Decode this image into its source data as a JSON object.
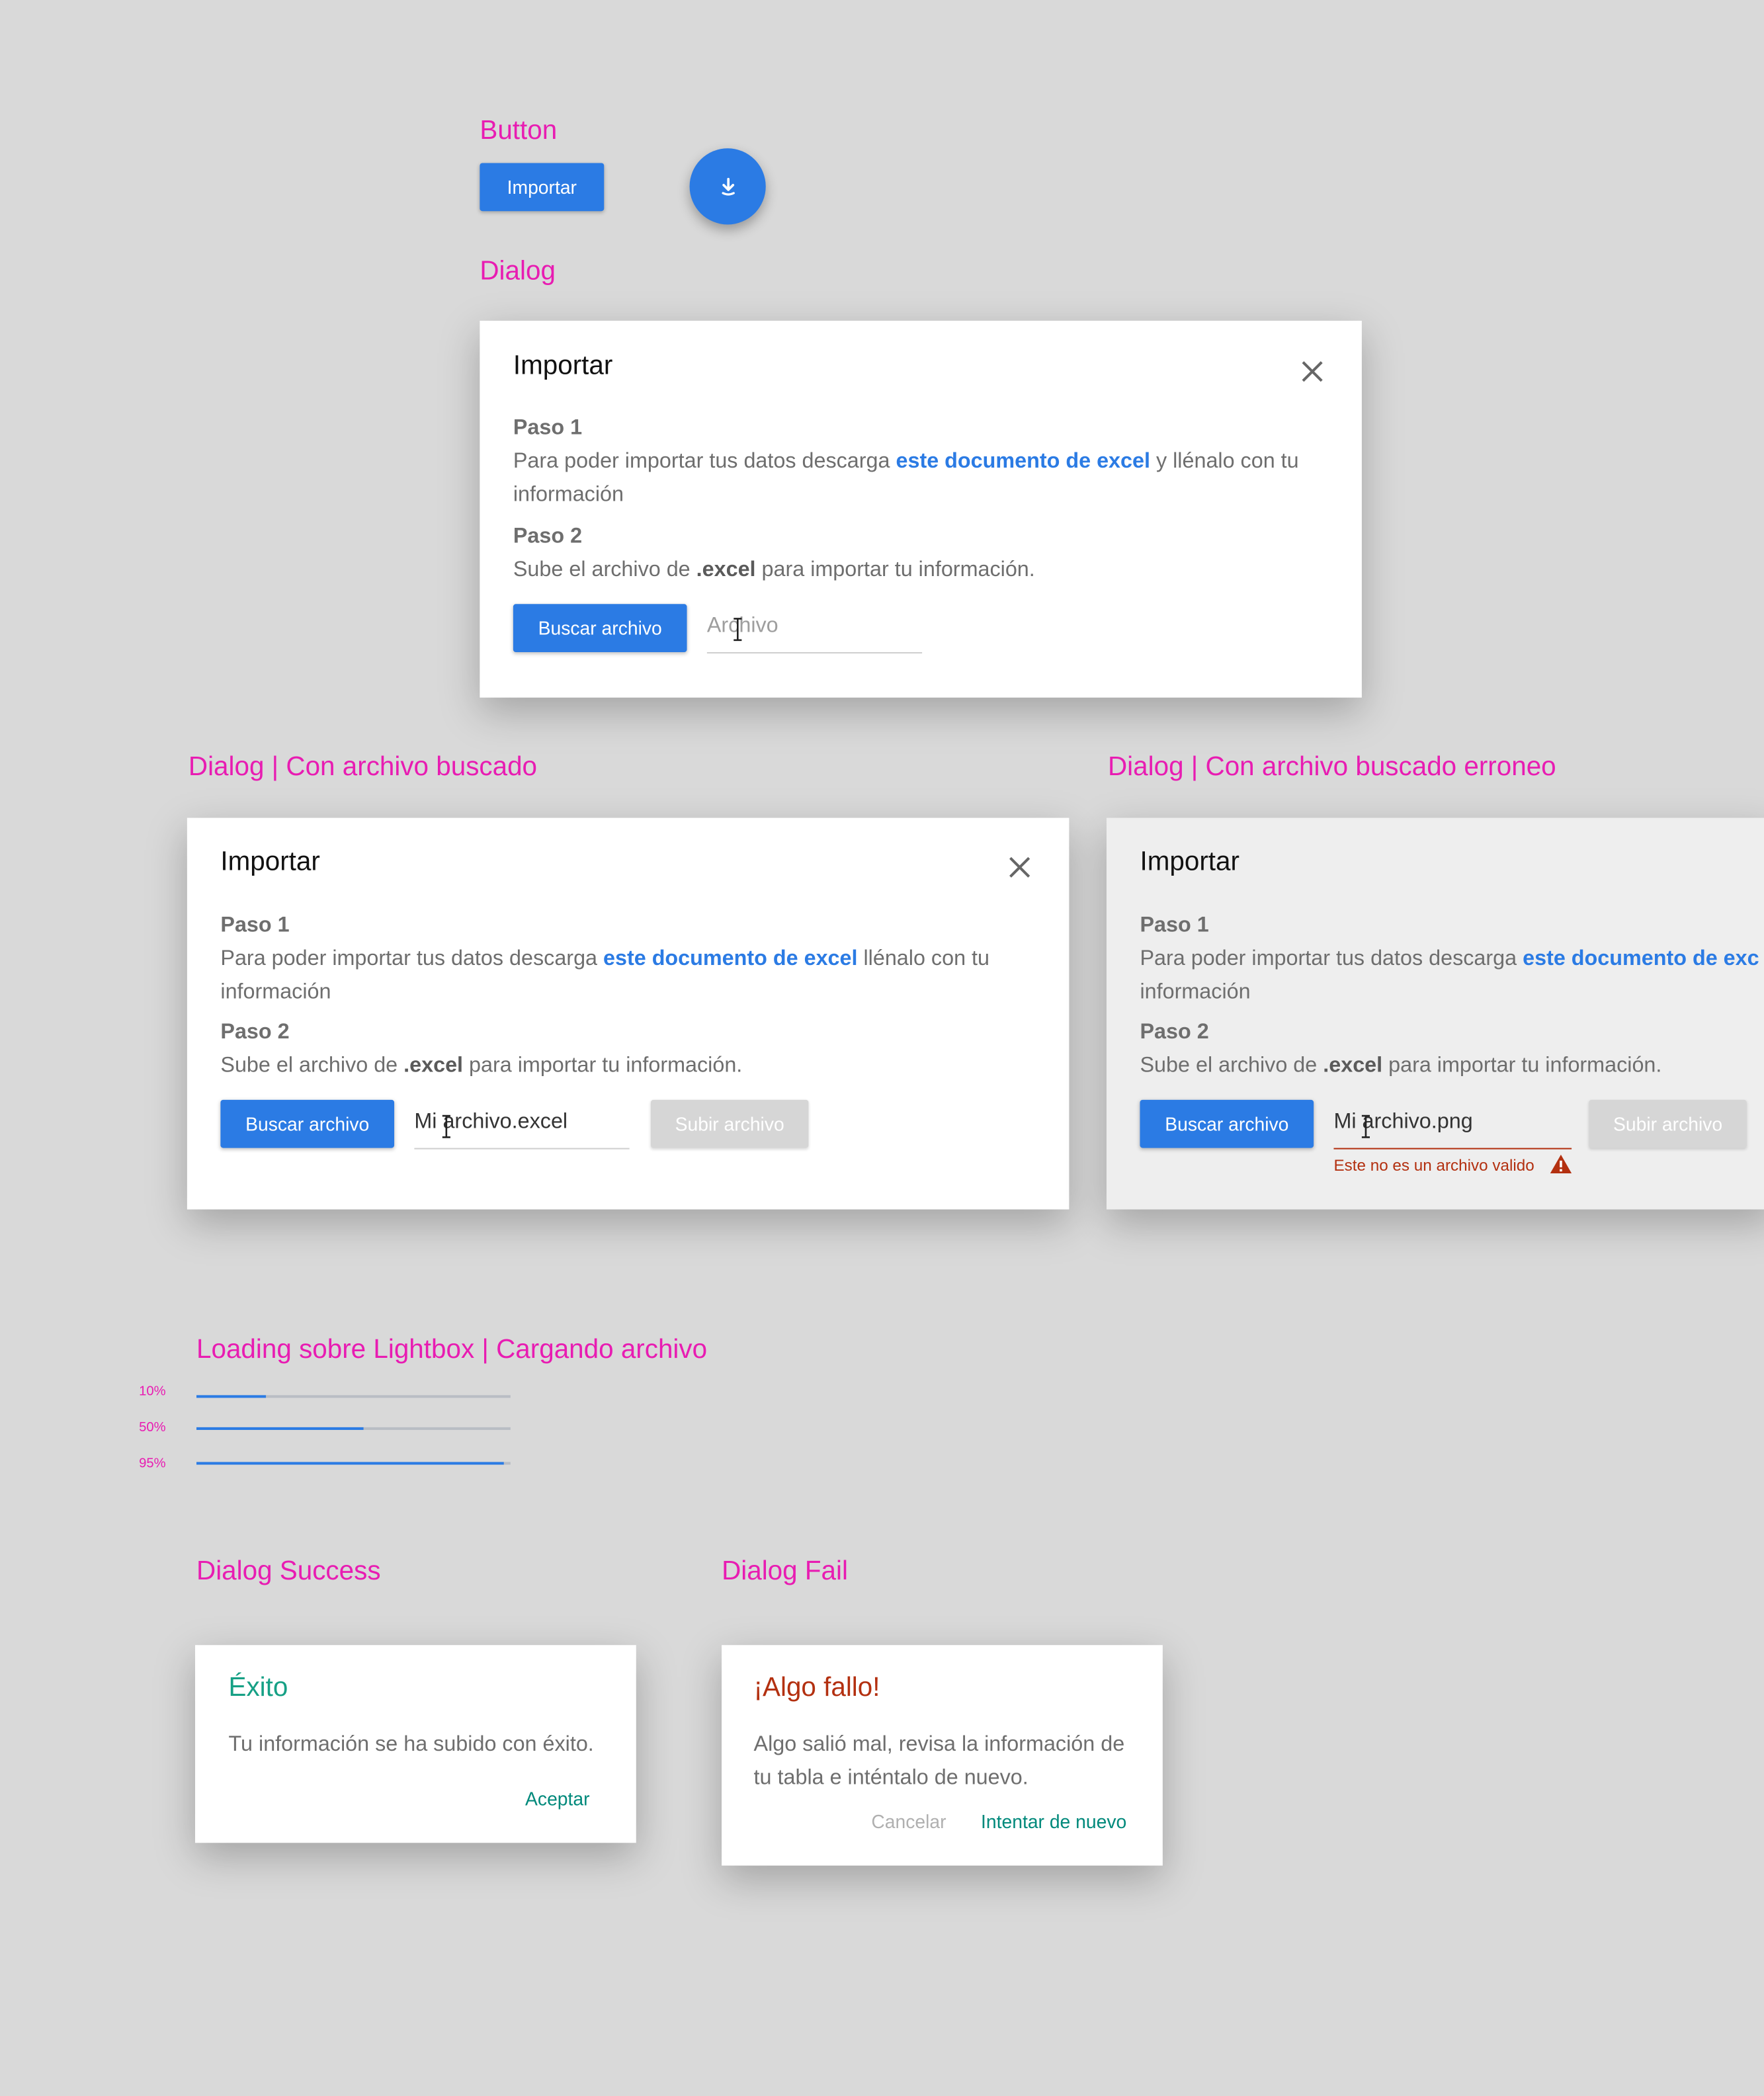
{
  "sections": {
    "button": "Button",
    "dialog": "Dialog",
    "dialog_found": "Dialog | Con archivo buscado",
    "dialog_error": "Dialog | Con archivo buscado erroneo",
    "loading": "Loading sobre Lightbox | Cargando archivo",
    "success": "Dialog Success",
    "fail": "Dialog Fail"
  },
  "import_button": {
    "label": "Importar"
  },
  "fab": {
    "icon": "download-icon"
  },
  "dialog_empty": {
    "title": "Importar",
    "step1": "Paso 1",
    "step1_text_a": "Para poder importar tus datos descarga ",
    "step1_link": "este documento de excel",
    "step1_text_b": " y llénalo con tu información",
    "step2": "Paso 2",
    "step2_text_a": "Sube el archivo de ",
    "step2_bold": ".excel",
    "step2_text_b": "  para importar tu información.",
    "browse_button": "Buscar archivo",
    "file_placeholder": "Archivo"
  },
  "dialog_found": {
    "title": "Importar",
    "step1": "Paso 1",
    "step1_text_a": "Para poder importar tus datos descarga ",
    "step1_link": "este documento de excel",
    "step1_text_b": " llénalo con tu información",
    "step2": "Paso 2",
    "step2_text_a": "Sube el archivo de ",
    "step2_bold": ".excel",
    "step2_text_b": "  para importar tu información.",
    "browse_button": "Buscar archivo",
    "file_value": "Mi archivo.excel",
    "upload_button": "Subir archivo"
  },
  "dialog_error": {
    "title": "Importar",
    "step1": "Paso 1",
    "step1_text_a": "Para poder importar tus datos descarga ",
    "step1_link": "este documento de exc",
    "step1_text_b": "información",
    "step2": "Paso 2",
    "step2_text_a": "Sube el archivo de ",
    "step2_bold": ".excel",
    "step2_text_b": "  para importar tu información.",
    "browse_button": "Buscar archivo",
    "file_value": "Mi archivo.png",
    "upload_button": "Subir archivo",
    "error_message": "Este no es un archivo valido",
    "error_color": "#b33010"
  },
  "progress": [
    {
      "label": "10%",
      "value": 0.22
    },
    {
      "label": "50%",
      "value": 0.53
    },
    {
      "label": "95%",
      "value": 0.98
    }
  ],
  "success_dialog": {
    "title": "Éxito",
    "message": "Tu información se ha subido con éxito.",
    "accept": "Aceptar",
    "title_color": "#16a085"
  },
  "fail_dialog": {
    "title": "¡Algo fallo!",
    "message": "Algo salió mal, revisa la información de tu tabla e inténtalo de nuevo.",
    "cancel": "Cancelar",
    "retry": "Intentar de nuevo",
    "title_color": "#b33010"
  },
  "colors": {
    "accent": "#2b7be4",
    "section_title": "#e81cb2",
    "teal": "#00897b",
    "background": "#d9d9d9"
  }
}
